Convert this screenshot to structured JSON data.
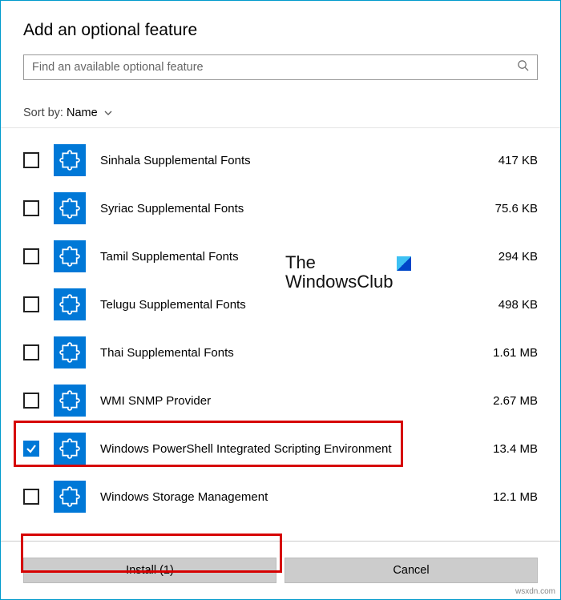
{
  "title": "Add an optional feature",
  "search": {
    "placeholder": "Find an available optional feature"
  },
  "sort": {
    "label": "Sort by:",
    "value": "Name"
  },
  "items": [
    {
      "label": "Sinhala Supplemental Fonts",
      "size": "417 KB",
      "checked": false
    },
    {
      "label": "Syriac Supplemental Fonts",
      "size": "75.6 KB",
      "checked": false
    },
    {
      "label": "Tamil Supplemental Fonts",
      "size": "294 KB",
      "checked": false
    },
    {
      "label": "Telugu Supplemental Fonts",
      "size": "498 KB",
      "checked": false
    },
    {
      "label": "Thai Supplemental Fonts",
      "size": "1.61 MB",
      "checked": false
    },
    {
      "label": "WMI SNMP Provider",
      "size": "2.67 MB",
      "checked": false
    },
    {
      "label": "Windows PowerShell Integrated Scripting Environment",
      "size": "13.4 MB",
      "checked": true
    },
    {
      "label": "Windows Storage Management",
      "size": "12.1 MB",
      "checked": false
    }
  ],
  "buttons": {
    "install": "Install (1)",
    "cancel": "Cancel"
  },
  "watermark": {
    "l1": "The",
    "l2": "WindowsClub"
  },
  "credit": "wsxdn.com"
}
